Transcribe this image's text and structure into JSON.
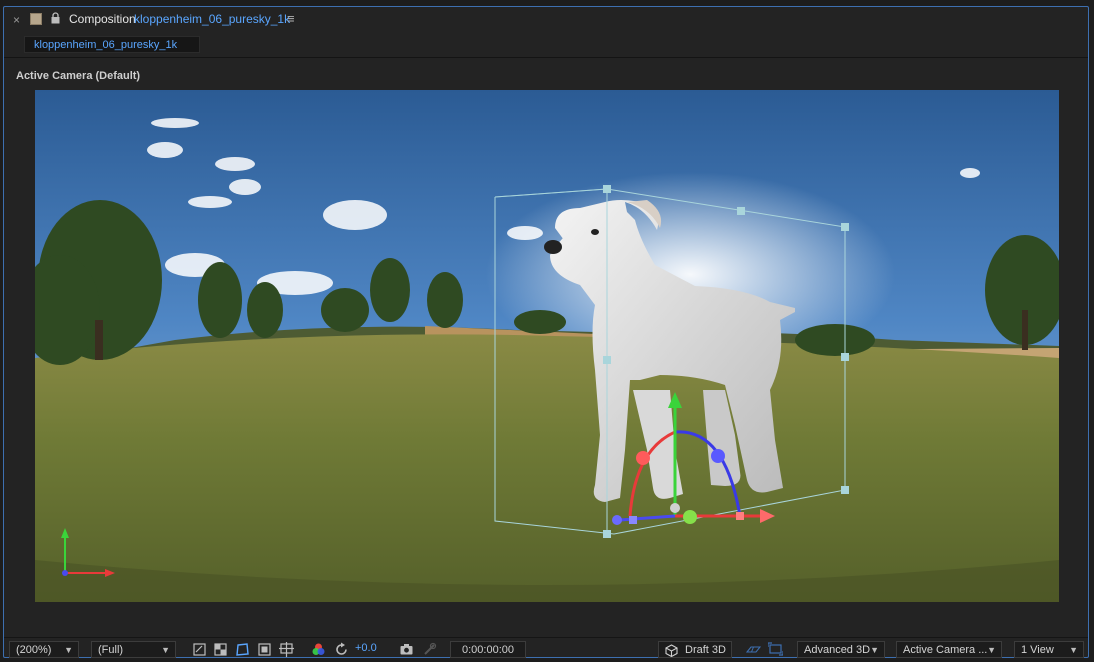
{
  "panel": {
    "close_glyph": "×",
    "title_label": "Composition",
    "composition_name": "kloppenheim_06_puresky_1k",
    "menu_glyph": "≡",
    "tab_label": "kloppenheim_06_puresky_1k"
  },
  "viewer": {
    "camera_label": "Active Camera (Default)"
  },
  "toolbar": {
    "magnification": "(200%)",
    "resolution": "(Full)",
    "exposure": "+0.0",
    "timecode": "0:00:00:00",
    "draft_3d": "Draft 3D",
    "renderer": "Advanced 3D",
    "camera": "Active Camera ...",
    "views": "1 View"
  },
  "colors": {
    "accent_blue": "#5aa6ff",
    "panel_border": "#3d6fb0",
    "gizmo_x": "#e83a3a",
    "gizmo_y": "#3ad43a",
    "gizmo_z": "#4a4af0"
  },
  "icons": [
    "close-icon",
    "color-swatch-icon",
    "lock-icon",
    "panel-menu-icon",
    "region-of-interest-icon",
    "transparency-grid-icon",
    "mask-path-visibility-icon",
    "guides-icon",
    "grid-options-icon",
    "color-channels-icon",
    "reset-exposure-icon",
    "snapshot-icon",
    "show-snapshot-icon",
    "draft-3d-icon",
    "3d-ground-plane-icon",
    "extended-viewer-icon"
  ]
}
